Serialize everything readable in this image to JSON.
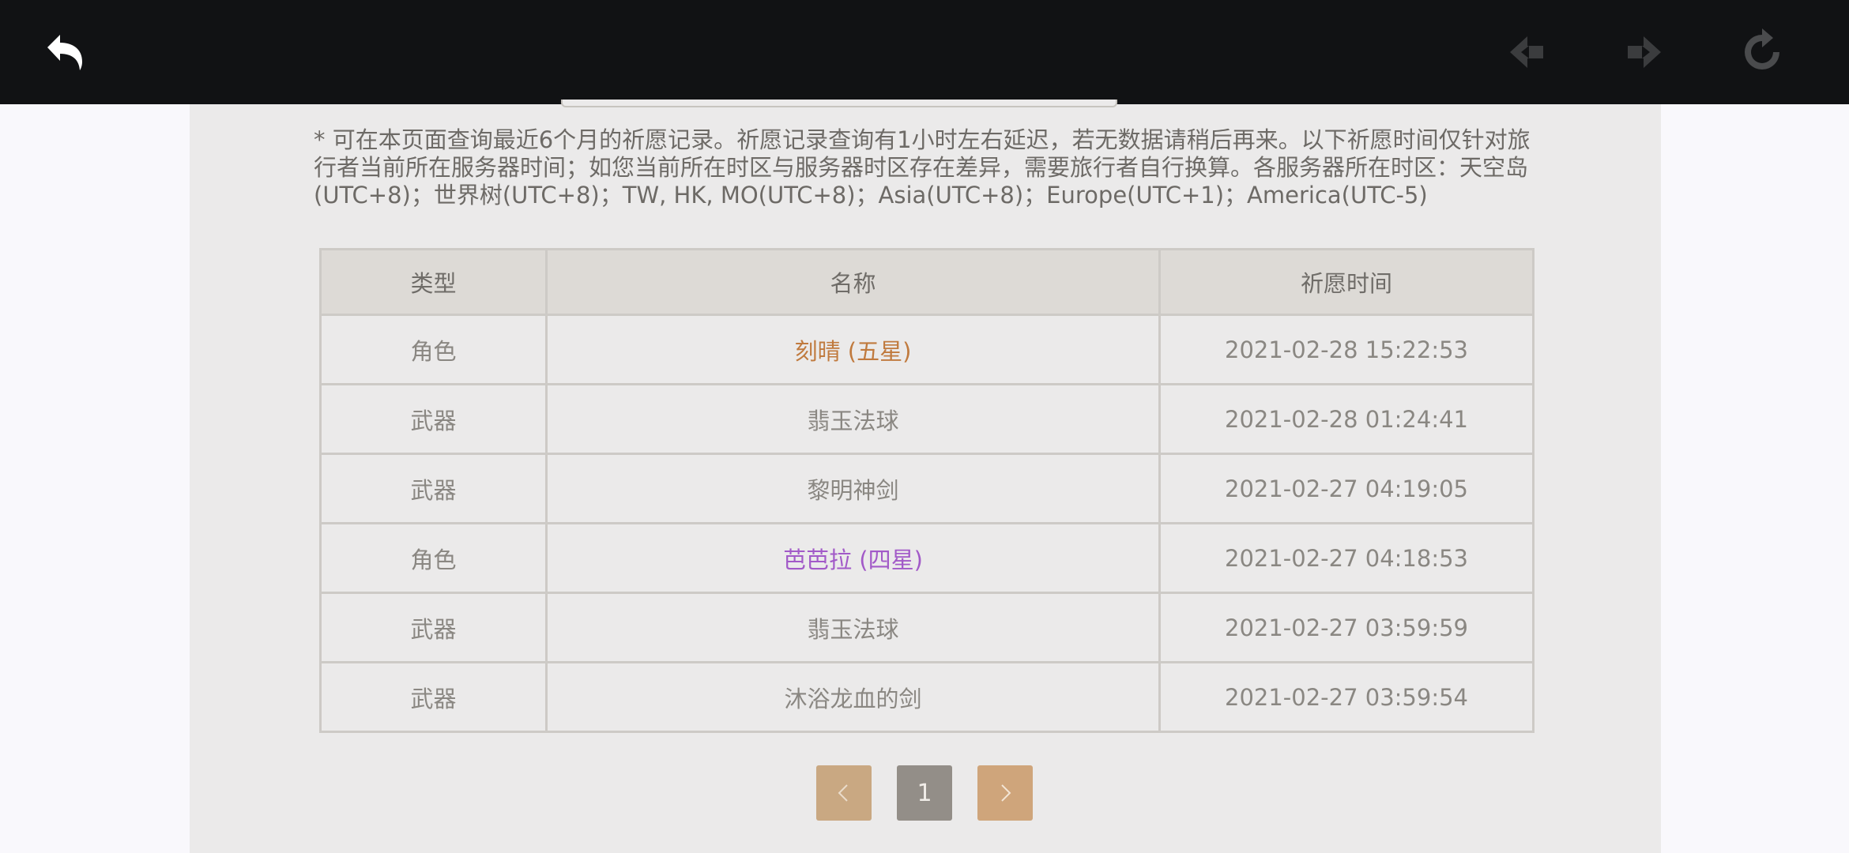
{
  "toolbar": {
    "back_icon": "back-arrow-icon",
    "nav_back_icon": "nav-back-icon",
    "nav_forward_icon": "nav-forward-icon",
    "refresh_icon": "refresh-icon"
  },
  "notice": "* 可在本页面查询最近6个月的祈愿记录。祈愿记录查询有1小时左右延迟，若无数据请稍后再来。以下祈愿时间仅针对旅行者当前所在服务器时间；如您当前所在时区与服务器时区存在差异，需要旅行者自行换算。各服务器所在时区：天空岛(UTC+8)；世界树(UTC+8)；TW, HK, MO(UTC+8)；Asia(UTC+8)；Europe(UTC+1)；America(UTC-5)",
  "table": {
    "headers": {
      "type": "类型",
      "name": "名称",
      "time": "祈愿时间"
    },
    "rows": [
      {
        "type": "角色",
        "name": "刻晴 (五星)",
        "time": "2021-02-28 15:22:53",
        "color": "#c07a3e"
      },
      {
        "type": "武器",
        "name": "翡玉法球",
        "time": "2021-02-28 01:24:41",
        "color": "#8a8782"
      },
      {
        "type": "武器",
        "name": "黎明神剑",
        "time": "2021-02-27 04:19:05",
        "color": "#8a8782"
      },
      {
        "type": "角色",
        "name": "芭芭拉 (四星)",
        "time": "2021-02-27 04:18:53",
        "color": "#a25ac8"
      },
      {
        "type": "武器",
        "name": "翡玉法球",
        "time": "2021-02-27 03:59:59",
        "color": "#8a8782"
      },
      {
        "type": "武器",
        "name": "沐浴龙血的剑",
        "time": "2021-02-27 03:59:54",
        "color": "#8a8782"
      }
    ]
  },
  "pagination": {
    "current_page": "1",
    "prev_icon": "chevron-left-icon",
    "next_icon": "chevron-right-icon"
  },
  "colors": {
    "topbar": "#111214",
    "panel": "#ebeaea",
    "five_star": "#c07a3e",
    "four_star": "#a25ac8",
    "pager_button": "#c9a882",
    "pager_current": "#938e88"
  }
}
